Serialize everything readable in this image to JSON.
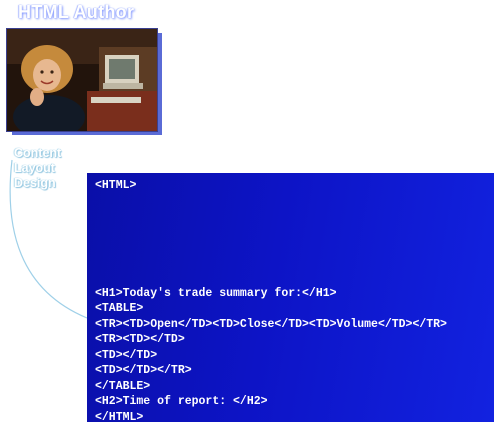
{
  "title": "HTML Author",
  "caption": [
    "Content",
    "Layout",
    "Design"
  ],
  "code": {
    "head": "<HTML>",
    "body_lines": [
      "<H1>Today's trade summary for:</H1>",
      "<TABLE>",
      "<TR><TD>Open</TD><TD>Close</TD><TD>Volume</TD></TR>",
      "<TR><TD></TD>",
      "<TD></TD>",
      "<TD></TD></TR>",
      "</TABLE>",
      "<H2>Time of report: </H2>",
      "</HTML>"
    ]
  },
  "colors": {
    "panel_start": "#0a0fa8",
    "panel_end": "#1222e0",
    "title_glow": "#7e93ff",
    "caption_glow": "#8ec3de",
    "connector": "#9fd0e8"
  },
  "icons": {
    "photo": "author-photo"
  }
}
